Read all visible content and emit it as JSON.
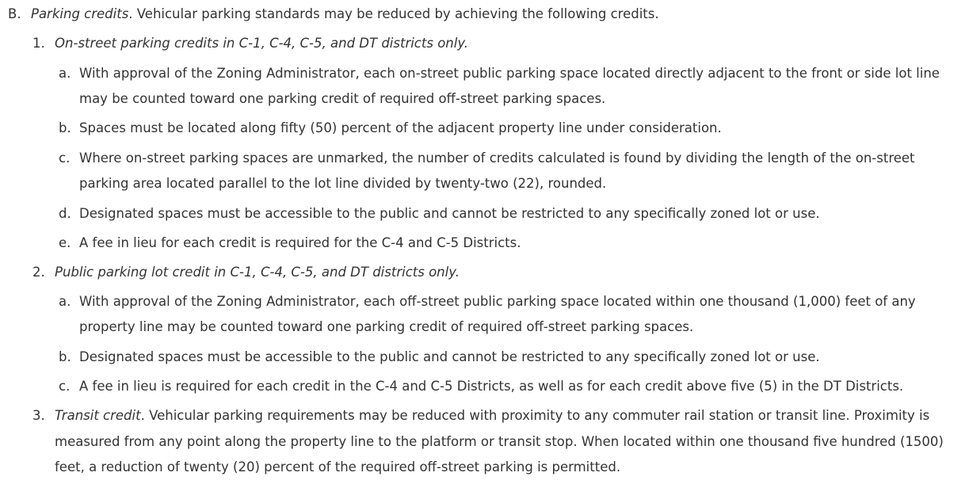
{
  "section": {
    "marker": "B.",
    "title": "Parking credits",
    "intro": ". Vehicular parking standards may be reduced by achieving the following credits.",
    "items": [
      {
        "marker": "1.",
        "title": "On-street parking credits in C-1, C-4, C-5, and DT districts only.",
        "subitems": [
          {
            "marker": "a.",
            "line1": "With approval of the Zoning Administrator, each on-street public parking space located directly adjacent to the front or side lot line",
            "line2": "may be counted toward one parking credit of required off-street parking spaces."
          },
          {
            "marker": "b.",
            "line1": "Spaces must be located along fifty (50) percent of the adjacent property line under consideration."
          },
          {
            "marker": "c.",
            "line1": "Where on-street parking spaces are unmarked, the number of credits calculated is found by dividing the length of the on-street",
            "line2": "parking area located parallel to the lot line divided by twenty-two (22), rounded."
          },
          {
            "marker": "d.",
            "line1": "Designated spaces must be accessible to the public and cannot be restricted to any specifically zoned lot or use."
          },
          {
            "marker": "e.",
            "line1": "A fee in lieu for each credit is required for the C-4 and C-5 Districts."
          }
        ]
      },
      {
        "marker": "2.",
        "title": "Public parking lot credit in C-1, C-4, C-5, and DT districts only.",
        "subitems": [
          {
            "marker": "a.",
            "line1": "With approval of the Zoning Administrator, each off-street public parking space located within one thousand (1,000) feet of any",
            "line2": "property line may be counted toward one parking credit of required off-street parking spaces."
          },
          {
            "marker": "b.",
            "line1": "Designated spaces must be accessible to the public and cannot be restricted to any specifically zoned lot or use."
          },
          {
            "marker": "c.",
            "line1": "A fee in lieu is required for each credit in the C-4 and C-5 Districts, as well as for each credit above five (5) in the DT Districts."
          }
        ]
      },
      {
        "marker": "3.",
        "title": "Transit credit",
        "line1": ". Vehicular parking requirements may be reduced with proximity to any commuter rail station or transit line. Proximity is",
        "line2": "measured from any point along the property line to the platform or transit stop. When located within one thousand five hundred (1500)",
        "line3": "feet, a reduction of twenty (20) percent of the required off-street parking is permitted."
      }
    ]
  },
  "colors": {
    "text": "#333333",
    "background": "#ffffff"
  }
}
